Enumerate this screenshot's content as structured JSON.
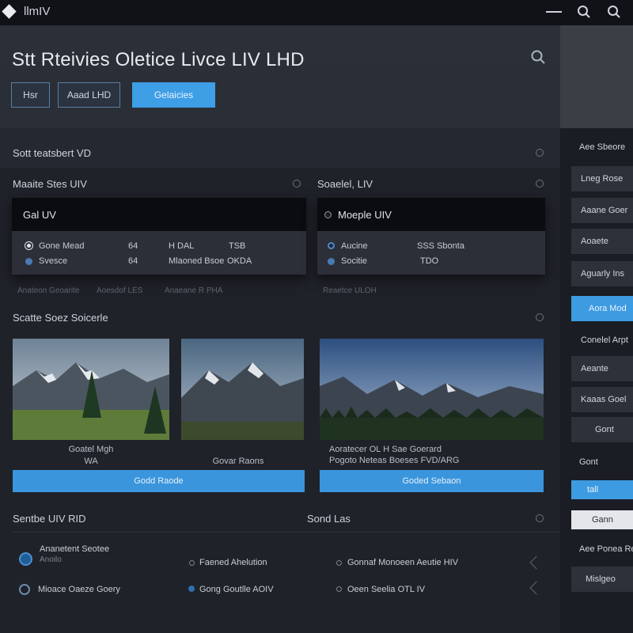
{
  "app": {
    "name": "llmIV"
  },
  "header": {
    "title": "Stt Rteivies Oletice Livce LIV LHD",
    "buttons": [
      "Hsr",
      "Aaad LHD",
      "Gelaicies"
    ]
  },
  "sections": {
    "strip_label": "Sott teatsbert VD",
    "left_heading": "Maaite Stes UIV",
    "right_heading": "Soaelel, LIV",
    "gallery_heading": "Scatte Soez Soicerle",
    "bottom_left_heading": "Sentbe UIV RID",
    "bottom_right_heading": "Sond Las"
  },
  "panels": {
    "left": {
      "head": "Gal UV",
      "rows": [
        {
          "label": "Gone Mead",
          "num": "64",
          "col3": "H DAL",
          "col4": "TSB"
        },
        {
          "label": "Svesce",
          "num": "64",
          "col3": "Mlaoned Bsoe",
          "col4": "OKDA"
        }
      ],
      "footnotes": [
        "Anateon Geoarite",
        "Aoesdof LES",
        "Anaeane R PHA"
      ]
    },
    "right": {
      "head": "Moeple UIV",
      "rows": [
        {
          "label": "Aucine",
          "value": "SSS Sbonta"
        },
        {
          "label": "Socitie",
          "value": "TDO"
        }
      ],
      "footnote": "Reaetce ULOH"
    }
  },
  "gallery": {
    "left_caption_1": "Goatel Mgh",
    "left_caption_2": "WA",
    "left_caption_3": "Govar Raons",
    "left_button": "Godd Raode",
    "right_caption_1": "Aoratecer OL H Sae Goerard",
    "right_caption_2": "Pogoto Neteas Boeses FVD/ARG",
    "right_button": "Goded Sebaon"
  },
  "list": {
    "left": [
      {
        "title": "Ananetent Seotee",
        "sub": "Anoilo"
      },
      {
        "title": "Mioace Oaeze Goery"
      }
    ],
    "middle": [
      "Faened Ahelution",
      "Gong Goutlle AOIV"
    ],
    "right": [
      "Gonnaf Monoeen Aeutie HIV",
      "Oeen Seelia OTL IV"
    ]
  },
  "sidebar": {
    "label_top": "Aee Sbeore",
    "items": [
      "Lneg Rose",
      "Aaane Goer",
      "Aoaete",
      "Aguarly Ins",
      "Aora Mod"
    ],
    "label_mid": "Conelel Arpt",
    "items2": [
      "Aeante",
      "Kaaas Goel",
      "Gont"
    ],
    "label_low": "Gont",
    "items3": [
      "tall",
      "Gann"
    ],
    "label_bottom": "Aee Ponea Re",
    "items4": [
      "Mislgeo"
    ]
  },
  "colors": {
    "accent": "#3e9ee6",
    "panel_dark": "#0b0c0f",
    "bg": "#1f2229"
  }
}
